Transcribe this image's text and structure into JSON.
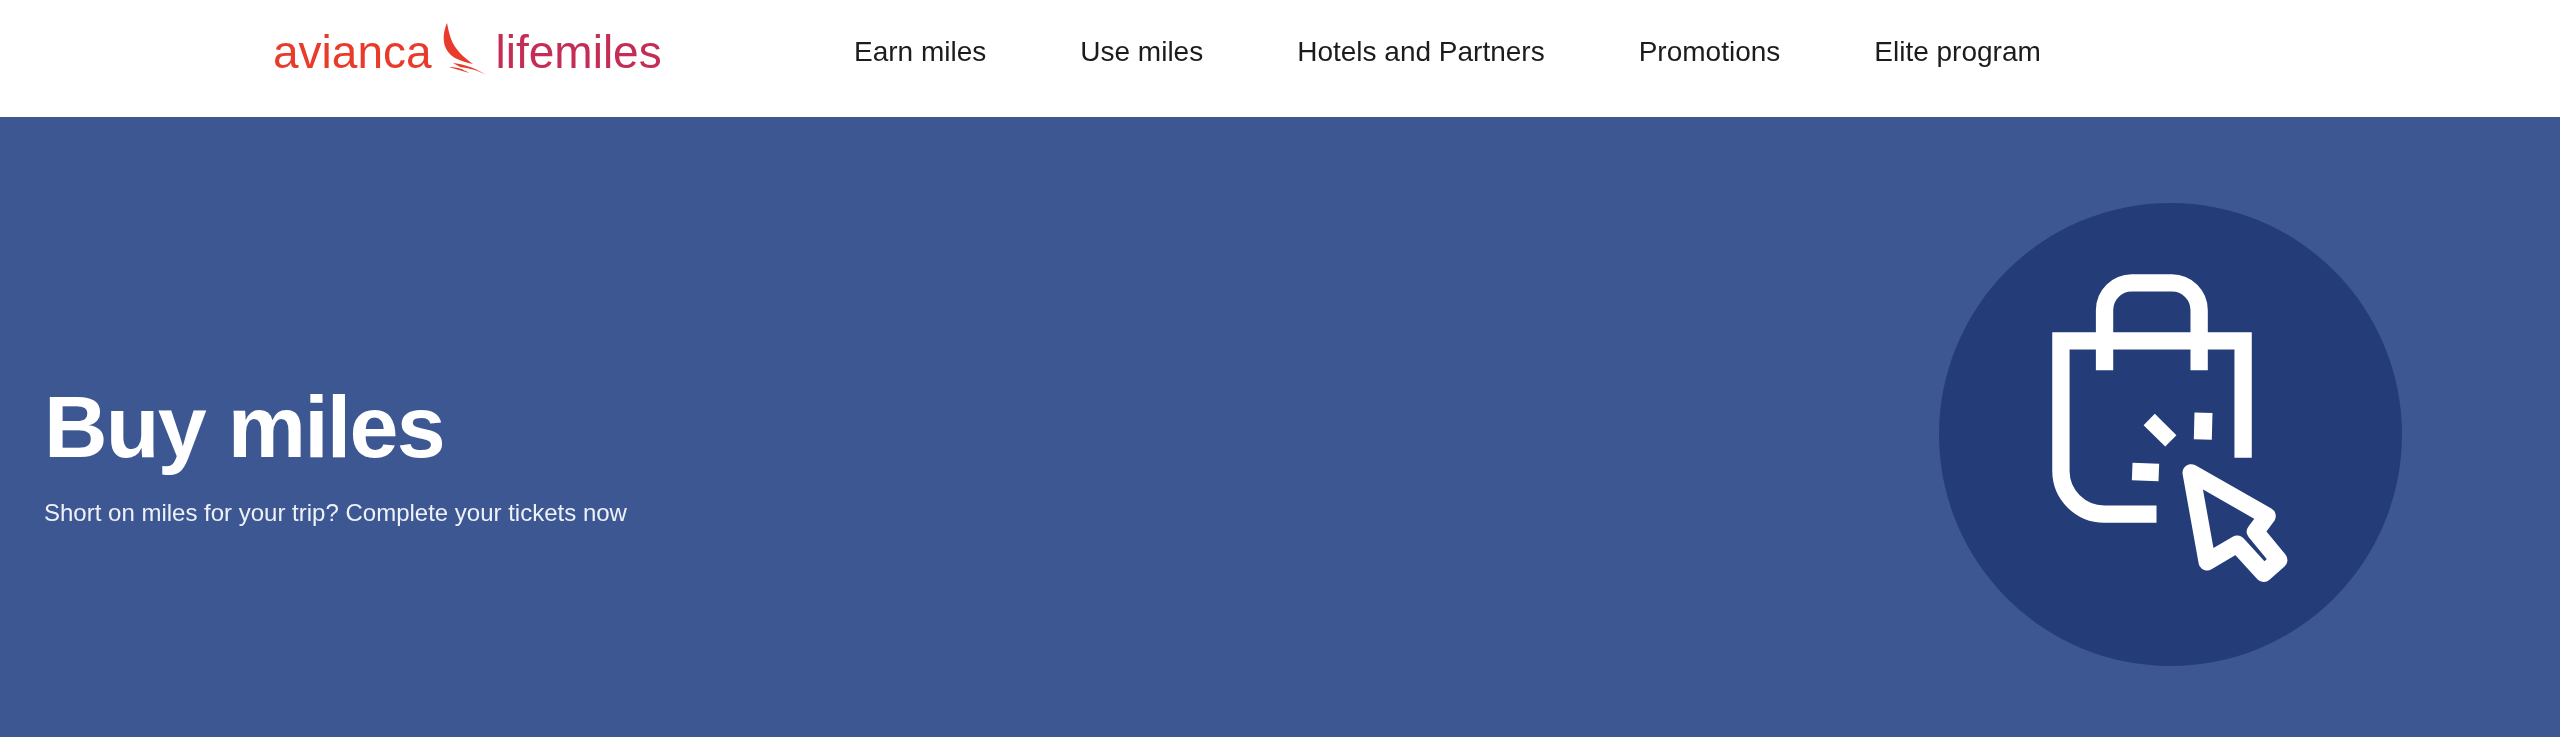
{
  "header": {
    "logo": {
      "brand": "avianca",
      "program": "lifemiles"
    },
    "nav": [
      "Earn miles",
      "Use miles",
      "Hotels and Partners",
      "Promotions",
      "Elite program"
    ]
  },
  "hero": {
    "title": "Buy miles",
    "subtitle": "Short on miles for your trip? Complete your tickets now"
  }
}
